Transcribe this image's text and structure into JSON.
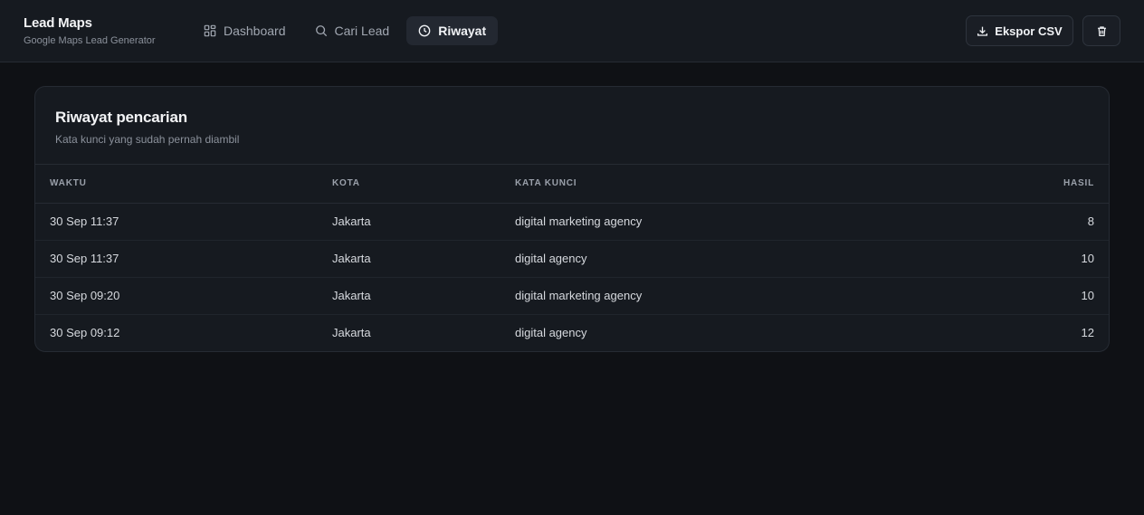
{
  "app": {
    "title": "Lead Maps",
    "subtitle": "Google Maps Lead Generator"
  },
  "nav": [
    {
      "label": "Dashboard",
      "icon": "grid-icon",
      "active": false
    },
    {
      "label": "Cari Lead",
      "icon": "search-icon",
      "active": false
    },
    {
      "label": "Riwayat",
      "icon": "clock-icon",
      "active": true
    }
  ],
  "actions": {
    "export_label": "Ekspor CSV",
    "trash_icon": "trash-icon"
  },
  "history": {
    "title": "Riwayat pencarian",
    "subtitle": "Kata kunci yang sudah pernah diambil",
    "columns": [
      "WAKTU",
      "KOTA",
      "KATA KUNCI",
      "HASIL"
    ],
    "rows": [
      [
        "30 Sep 11:37",
        "Jakarta",
        "digital marketing agency",
        "8"
      ],
      [
        "30 Sep 11:37",
        "Jakarta",
        "digital agency",
        "10"
      ],
      [
        "30 Sep 09:20",
        "Jakarta",
        "digital marketing agency",
        "10"
      ],
      [
        "30 Sep 09:12",
        "Jakarta",
        "digital agency",
        "12"
      ]
    ]
  }
}
